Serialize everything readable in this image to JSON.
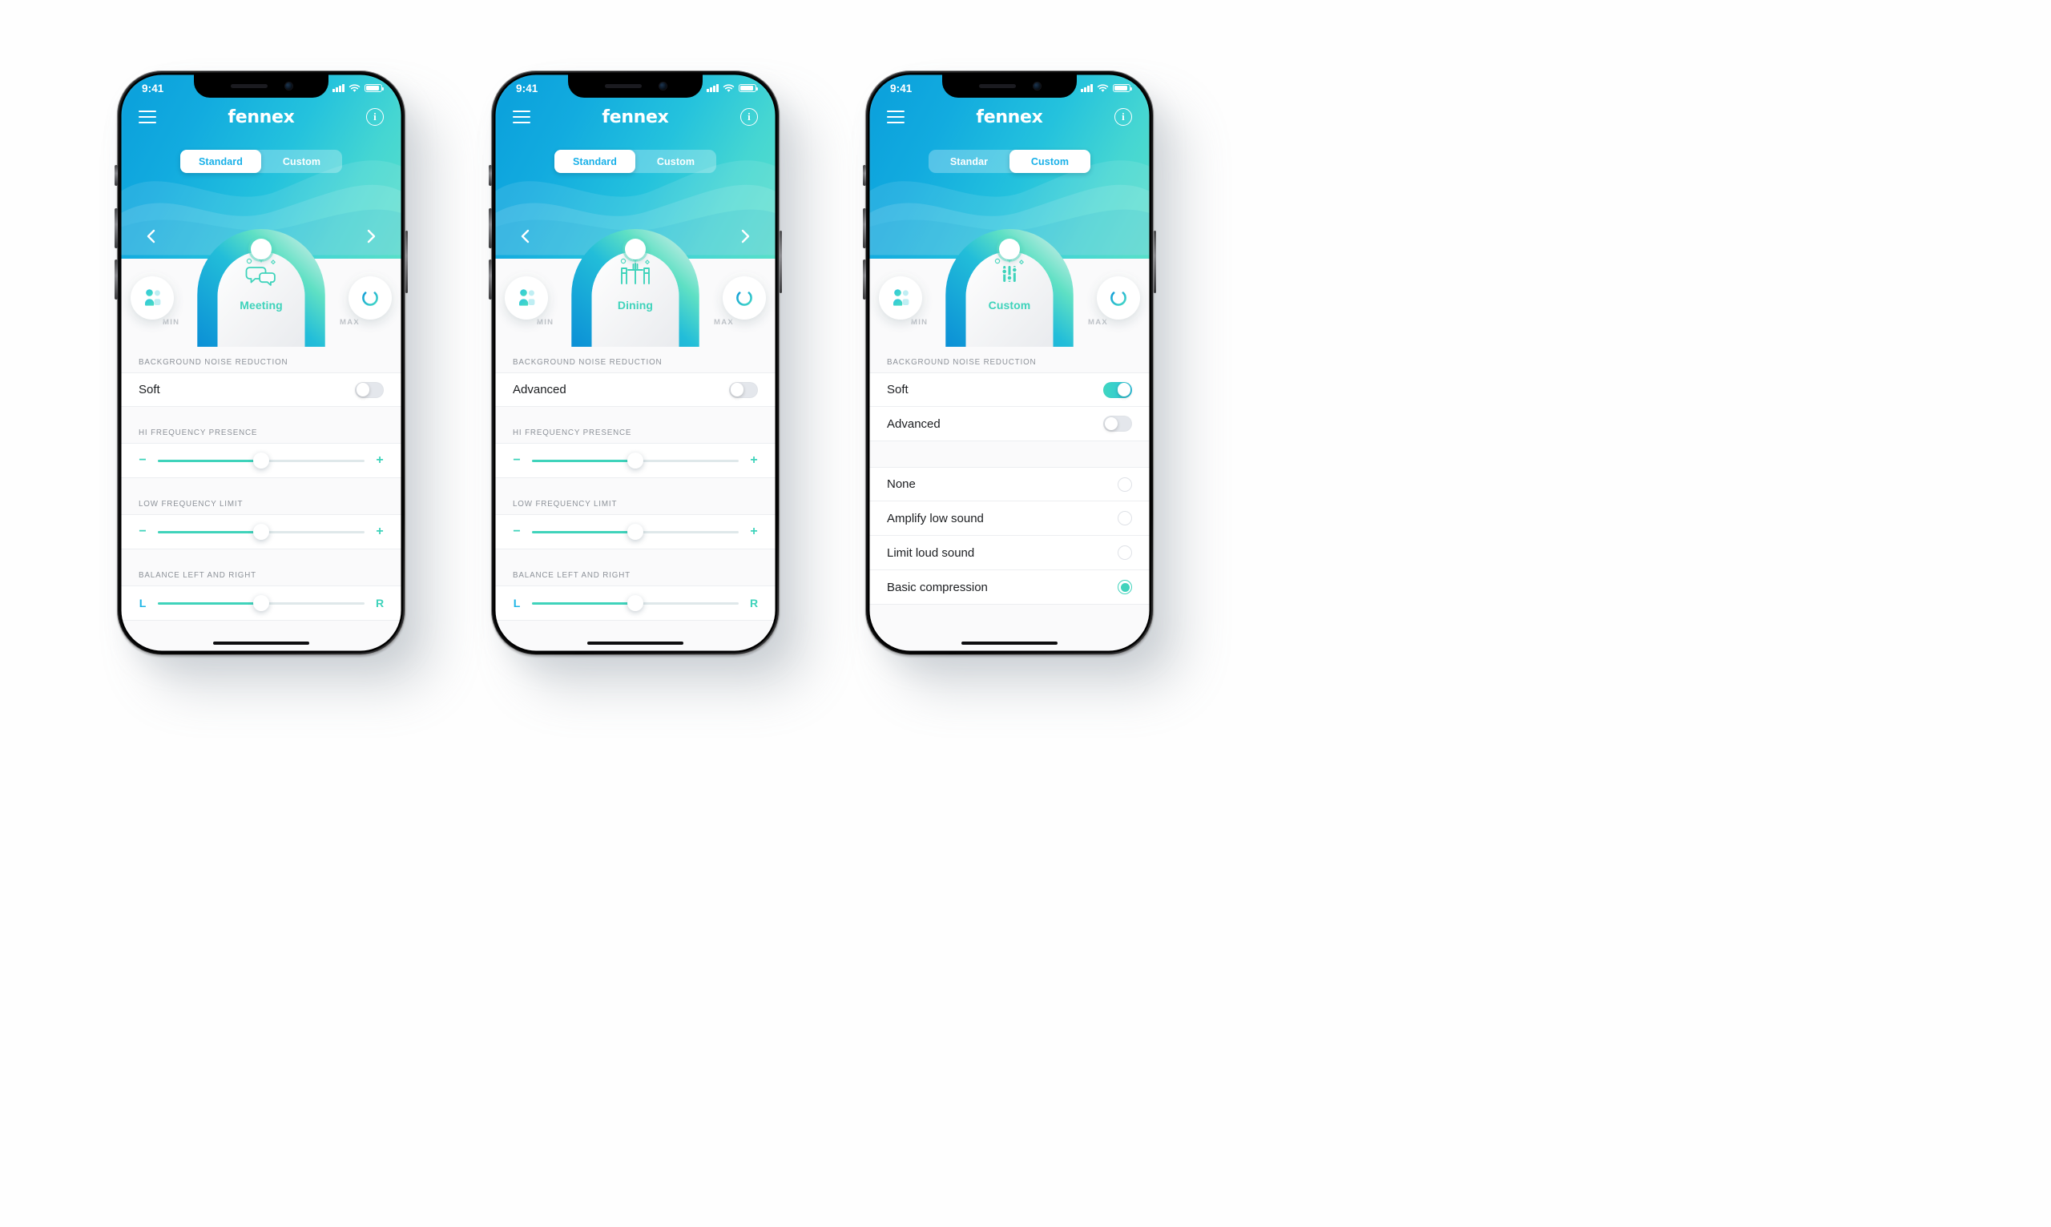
{
  "app": {
    "brand": "fennex",
    "status_time": "9:41",
    "icons": {
      "menu": "hamburger-icon",
      "info": "i",
      "signal": "signal-bars-icon",
      "wifi": "wifi-icon",
      "battery": "battery-icon"
    }
  },
  "segments": {
    "standard": "Standard",
    "custom": "Custom",
    "standard_short": "Standar"
  },
  "dial": {
    "min": "MIN",
    "max": "MAX",
    "prev": "chevron-left",
    "next": "chevron-right"
  },
  "sections": {
    "bnr": "BACKGROUND NOISE REDUCTION",
    "hi_freq": "HI FREQUENCY PRESENCE",
    "low_freq": "LOW FREQUENCY LIMIT",
    "balance": "BALANCE LEFT AND RIGHT"
  },
  "slider_ends": {
    "minus": "−",
    "plus": "+",
    "left": "L",
    "right": "R"
  },
  "phones": [
    {
      "id": "phone-meeting",
      "active_segment": "standard",
      "seg_left_label": "Standard",
      "seg_right_label": "Custom",
      "scene": {
        "name": "Meeting",
        "icon": "speech-bubbles-icon"
      },
      "bnr": {
        "label": "Soft",
        "on": false
      },
      "sliders": [
        {
          "name": "hi-frequency-presence",
          "value": 50
        },
        {
          "name": "low-frequency-limit",
          "value": 50
        },
        {
          "name": "balance-left-right",
          "value": 50
        }
      ]
    },
    {
      "id": "phone-dining",
      "active_segment": "standard",
      "seg_left_label": "Standard",
      "seg_right_label": "Custom",
      "scene": {
        "name": "Dining",
        "icon": "dining-table-icon"
      },
      "bnr": {
        "label": "Advanced",
        "on": false
      },
      "sliders": [
        {
          "name": "hi-frequency-presence",
          "value": 50
        },
        {
          "name": "low-frequency-limit",
          "value": 50
        },
        {
          "name": "balance-left-right",
          "value": 50
        }
      ]
    },
    {
      "id": "phone-custom",
      "active_segment": "custom",
      "seg_left_label": "Standar",
      "seg_right_label": "Custom",
      "scene": {
        "name": "Custom",
        "icon": "equalizer-sliders-icon"
      },
      "toggles": [
        {
          "label": "Soft",
          "on": true
        },
        {
          "label": "Advanced",
          "on": false
        }
      ],
      "options": [
        {
          "label": "None",
          "selected": false
        },
        {
          "label": "Amplify low sound",
          "selected": false
        },
        {
          "label": "Limit loud sound",
          "selected": false
        },
        {
          "label": "Basic compression",
          "selected": true
        }
      ]
    }
  ],
  "colors": {
    "accent_blue": "#18b0e8",
    "accent_teal": "#3fd3bb",
    "gradient_from": "#0a9fdb",
    "gradient_to": "#58e0c9",
    "text_dark": "#1b1d20",
    "text_muted": "#8d9299"
  }
}
